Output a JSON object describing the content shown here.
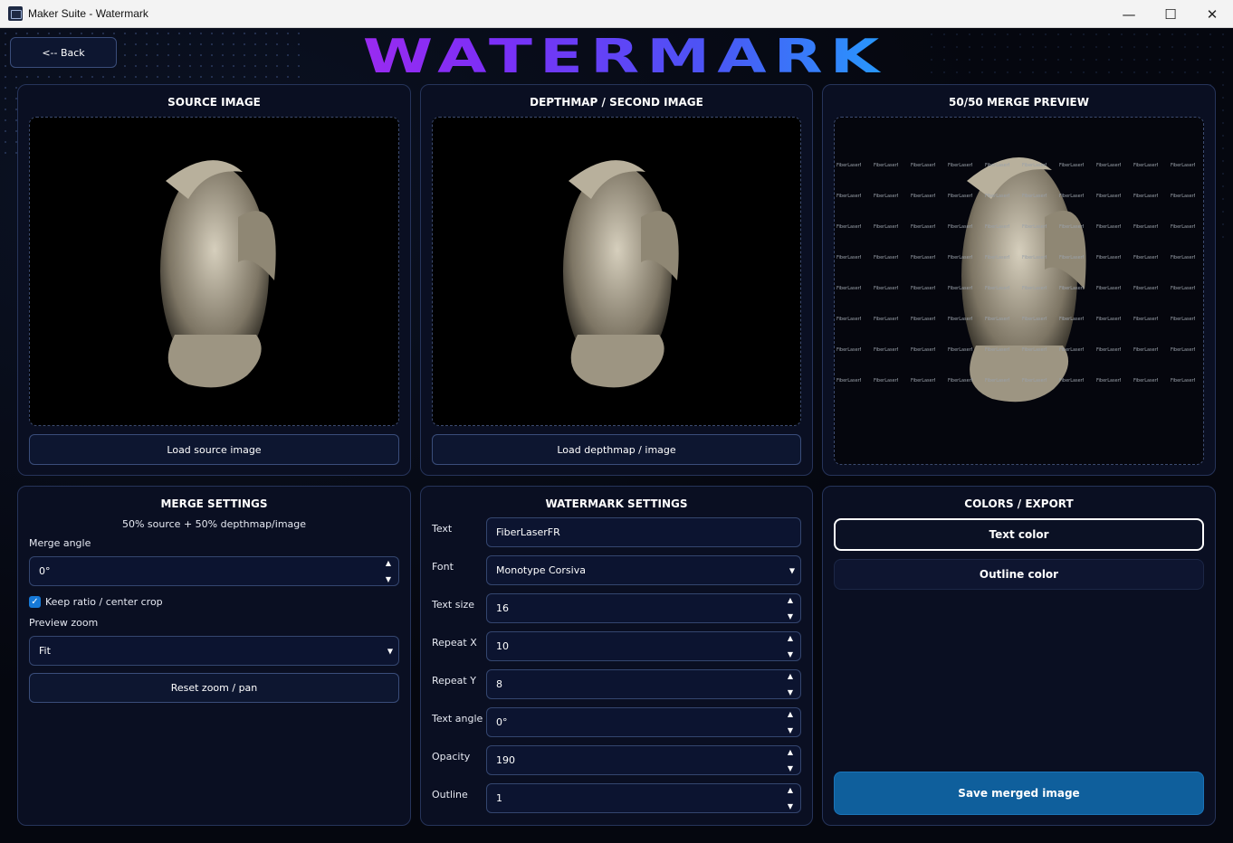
{
  "window": {
    "title": "Maker Suite - Watermark"
  },
  "header": {
    "back_label": "<-- Back",
    "brand": "WATERMARK"
  },
  "source_panel": {
    "title": "SOURCE IMAGE",
    "load_label": "Load source image"
  },
  "depth_panel": {
    "title": "DEPTHMAP / SECOND IMAGE",
    "load_label": "Load depthmap / image"
  },
  "preview_panel": {
    "title": "50/50 MERGE PREVIEW",
    "watermark_text": "FiberLaserFR"
  },
  "merge_settings": {
    "title": "MERGE SETTINGS",
    "subtitle": "50% source + 50% depthmap/image",
    "merge_angle_label": "Merge angle",
    "merge_angle_value": "0°",
    "keep_ratio_label": "Keep ratio / center crop",
    "keep_ratio_checked": true,
    "preview_zoom_label": "Preview zoom",
    "preview_zoom_value": "Fit",
    "reset_label": "Reset zoom / pan"
  },
  "watermark_settings": {
    "title": "WATERMARK SETTINGS",
    "fields": [
      {
        "label": "Text",
        "value": "FiberLaserFR",
        "kind": "text"
      },
      {
        "label": "Font",
        "value": "Monotype Corsiva",
        "kind": "dropdown"
      },
      {
        "label": "Text size",
        "value": "16",
        "kind": "spin"
      },
      {
        "label": "Repeat X",
        "value": "10",
        "kind": "spin"
      },
      {
        "label": "Repeat Y",
        "value": "8",
        "kind": "spin"
      },
      {
        "label": "Text angle",
        "value": "0°",
        "kind": "spin"
      },
      {
        "label": "Opacity",
        "value": "190",
        "kind": "spin"
      },
      {
        "label": "Outline",
        "value": "1",
        "kind": "spin"
      }
    ]
  },
  "colors_export": {
    "title": "COLORS / EXPORT",
    "text_color_label": "Text color",
    "outline_color_label": "Outline color",
    "save_label": "Save merged image"
  },
  "colors": {
    "accent": "#1679d8",
    "save_button": "#0f5f9c",
    "panel": "#0a0f22",
    "border": "#26345a"
  }
}
